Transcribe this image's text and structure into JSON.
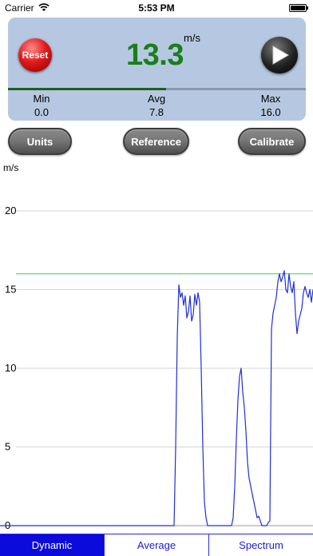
{
  "status_bar": {
    "carrier": "Carrier",
    "time": "5:53 PM"
  },
  "meter": {
    "reset_label": "Reset",
    "unit": "m/s",
    "current_value": "13.3",
    "level_fraction": 0.53,
    "stats": [
      {
        "label": "Min",
        "value": "0.0"
      },
      {
        "label": "Avg",
        "value": "7.8"
      },
      {
        "label": "Max",
        "value": "16.0"
      }
    ]
  },
  "buttons": {
    "units": "Units",
    "reference": "Reference",
    "calibrate": "Calibrate"
  },
  "tabs": [
    {
      "label": "Dynamic",
      "active": true
    },
    {
      "label": "Average",
      "active": false
    },
    {
      "label": "Spectrum",
      "active": false
    }
  ],
  "colors": {
    "panel": "#b6c8e1",
    "value_green": "#1a7f1a",
    "series_blue": "#1f2fd6",
    "max_line_green": "#33dd33",
    "tab_active": "#0b0bdb"
  },
  "chart_data": {
    "type": "line",
    "ylabel": "m/s",
    "ylim": [
      0,
      20
    ],
    "yticks": [
      0,
      5,
      10,
      15,
      20
    ],
    "grid": true,
    "reference_line": 16.0,
    "x": [
      0,
      218,
      220,
      222,
      224,
      226,
      228,
      230,
      232,
      234,
      236,
      238,
      240,
      242,
      244,
      246,
      248,
      250,
      252,
      254,
      256,
      258,
      260,
      262,
      290,
      292,
      294,
      296,
      298,
      300,
      302,
      304,
      306,
      308,
      310,
      312,
      314,
      316,
      318,
      320,
      322,
      324,
      326,
      328,
      330,
      332,
      334,
      336,
      338,
      340,
      342,
      344,
      346,
      348,
      350,
      352,
      354,
      356,
      358,
      360,
      362,
      364,
      366,
      368,
      370,
      372,
      374,
      376,
      378,
      380,
      382,
      384,
      386,
      388,
      390,
      392
    ],
    "series": [
      {
        "values": [
          0,
          0,
          5,
          12,
          15.3,
          14.5,
          14.8,
          14.0,
          14.6,
          13.2,
          13.6,
          14.6,
          13.0,
          13.4,
          14.7,
          14.0,
          14.8,
          14.2,
          10.0,
          5.0,
          1.5,
          0.5,
          0,
          0,
          0,
          0.5,
          2.5,
          5.5,
          8.0,
          9.5,
          10.0,
          8.5,
          7.5,
          6.0,
          4.0,
          3.0,
          2.5,
          2.0,
          1.5,
          1.0,
          0.5,
          0.6,
          0.3,
          0,
          0,
          0,
          0,
          0.2,
          0.3,
          12.5,
          13.5,
          14.0,
          14.5,
          15.5,
          16.0,
          15.5,
          15.8,
          16.2,
          15.0,
          14.8,
          16.0,
          15.2,
          14.8,
          15.5,
          13.5,
          12.2,
          13.0,
          13.4,
          13.8,
          14.8,
          15.2,
          14.8,
          14.5,
          15.0,
          14.2,
          15.0
        ]
      }
    ]
  }
}
